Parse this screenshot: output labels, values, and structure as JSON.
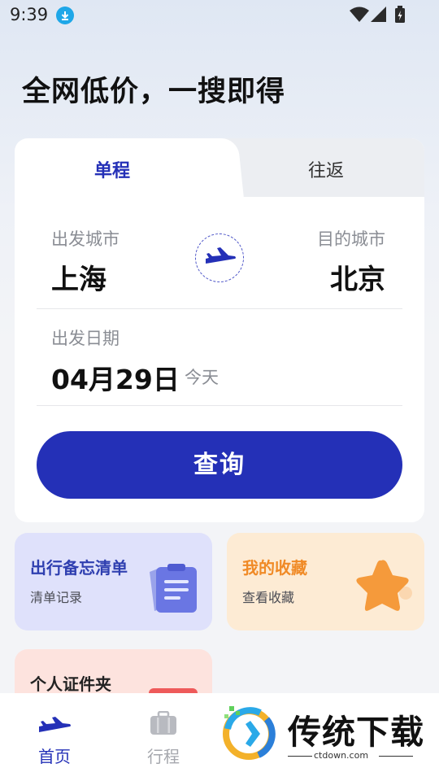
{
  "status_bar": {
    "time": "9:39"
  },
  "headline": "全网低价，一搜即得",
  "search_card": {
    "tabs": [
      {
        "label": "单程",
        "selected": true
      },
      {
        "label": "往返",
        "selected": false
      }
    ],
    "departure_label": "出发城市",
    "departure_city": "上海",
    "arrival_label": "目的城市",
    "arrival_city": "北京",
    "date_label": "出发日期",
    "date_value": "04月29日",
    "date_hint": "今天",
    "search_button": "查询"
  },
  "tiles": {
    "checklist": {
      "title": "出行备忘清单",
      "subtitle": "清单记录"
    },
    "favorites": {
      "title": "我的收藏",
      "subtitle": "查看收藏"
    },
    "id_folder": {
      "title": "个人证件夹"
    }
  },
  "bottom_nav": {
    "items": [
      {
        "label": "首页",
        "icon": "plane-icon",
        "active": true
      },
      {
        "label": "行程",
        "icon": "suitcase-icon",
        "active": false
      }
    ]
  },
  "watermark": {
    "brand": "传统下载",
    "url": "ctdown.com"
  },
  "colors": {
    "primary": "#2430b7",
    "orange": "#f08a26",
    "background": "#f3f4f7"
  }
}
